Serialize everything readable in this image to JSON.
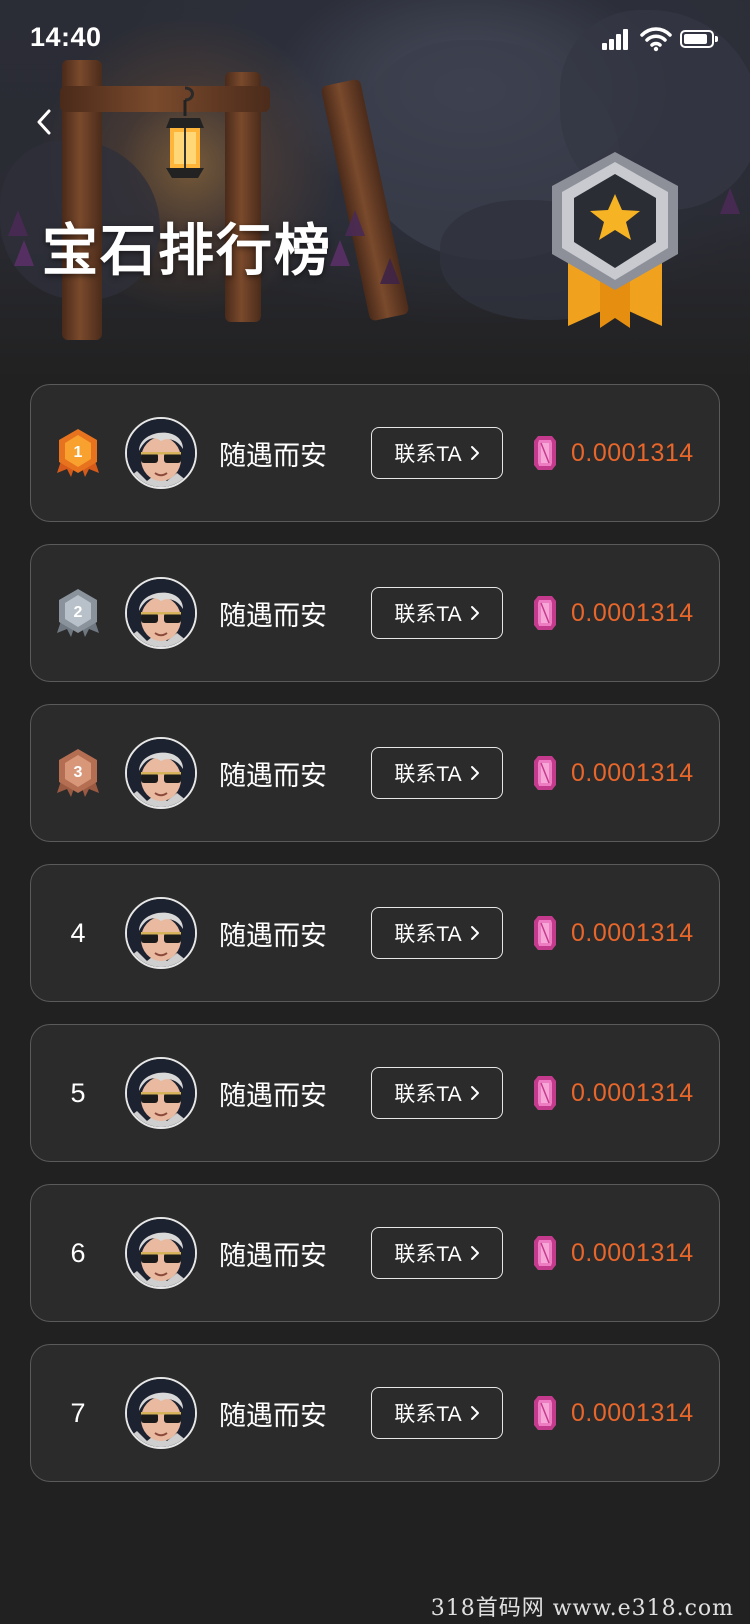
{
  "status_bar": {
    "time": "14:40"
  },
  "header": {
    "title": "宝石排行榜"
  },
  "list": {
    "contact_label": "联系TA",
    "currency_icon": "gem-icon",
    "rows": [
      {
        "rank": "1",
        "rank_badge": "gold",
        "name": "随遇而安",
        "value": "0.0001314"
      },
      {
        "rank": "2",
        "rank_badge": "silver",
        "name": "随遇而安",
        "value": "0.0001314"
      },
      {
        "rank": "3",
        "rank_badge": "bronze",
        "name": "随遇而安",
        "value": "0.0001314"
      },
      {
        "rank": "4",
        "rank_badge": "",
        "name": "随遇而安",
        "value": "0.0001314"
      },
      {
        "rank": "5",
        "rank_badge": "",
        "name": "随遇而安",
        "value": "0.0001314"
      },
      {
        "rank": "6",
        "rank_badge": "",
        "name": "随遇而安",
        "value": "0.0001314"
      },
      {
        "rank": "7",
        "rank_badge": "",
        "name": "随遇而安",
        "value": "0.0001314"
      }
    ]
  },
  "colors": {
    "accent_value": "#e8662a",
    "background": "#212121",
    "card_border": "#5a5a5a"
  },
  "watermark": "318首码网  www.e318.com"
}
